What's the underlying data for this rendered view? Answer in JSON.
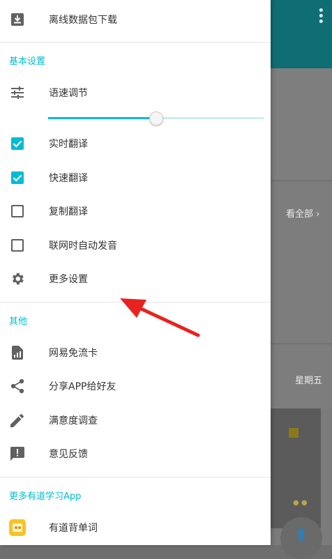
{
  "background": {
    "view_all": "看全部 ›",
    "weekday": "星期五"
  },
  "drawer": {
    "offline_download": "离线数据包下载",
    "section_basic": "基本设置",
    "speech_speed": "语速调节",
    "speech_speed_level": 0.5,
    "realtime_translate": {
      "label": "实时翻译",
      "checked": true
    },
    "quick_translate": {
      "label": "快速翻译",
      "checked": true
    },
    "copy_translate": {
      "label": "复制翻译",
      "checked": false
    },
    "auto_pronounce": {
      "label": "联网时自动发音",
      "checked": false
    },
    "more_settings": "更多设置",
    "section_other": "其他",
    "free_data_card": "网易免流卡",
    "share_app": "分享APP给好友",
    "survey": "满意度调查",
    "feedback": "意见反馈",
    "section_more_apps": "更多有道学习App",
    "vocab_app": "有道背单词"
  },
  "colors": {
    "accent": "#00bcd4",
    "annotation_arrow": "#e8231f"
  }
}
